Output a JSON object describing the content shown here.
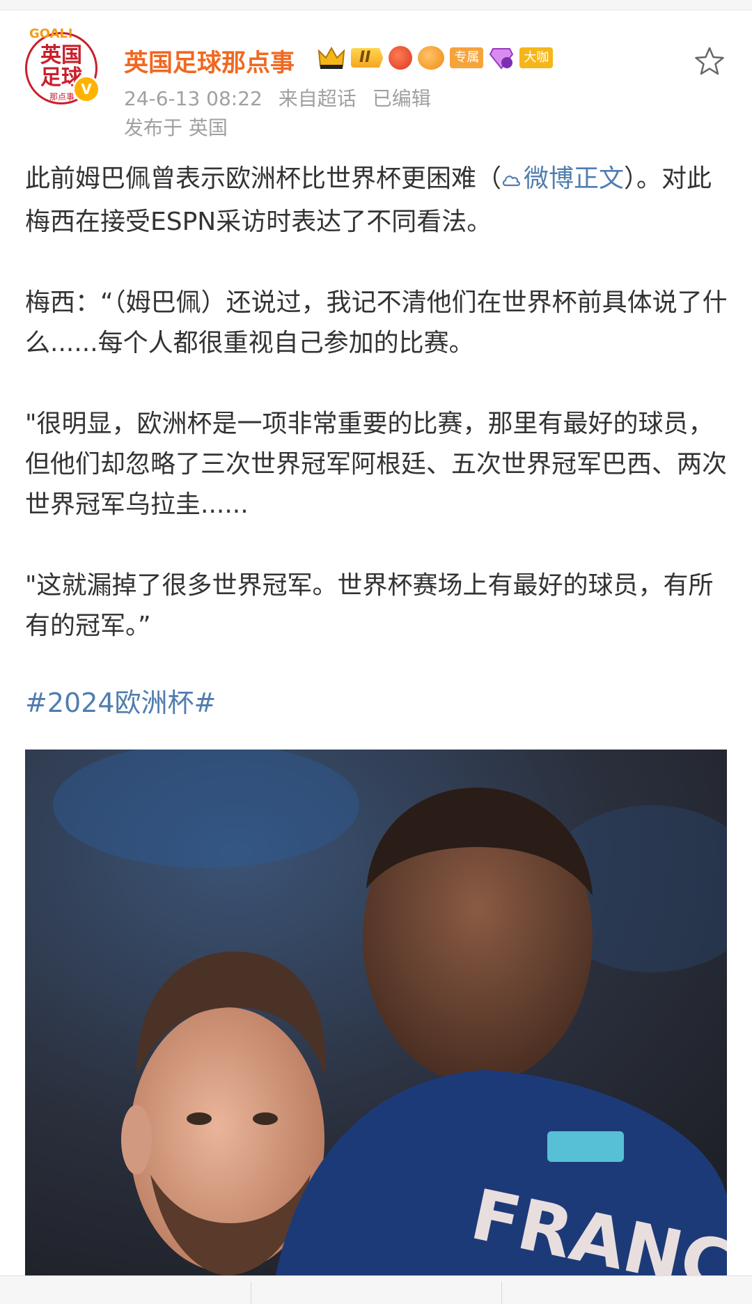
{
  "user": {
    "name": "英国足球那点事",
    "avatar_text_line1": "英国",
    "avatar_text_line2": "足球",
    "avatar_goal": "GOAL!",
    "avatar_small": "那点事",
    "verified": "V",
    "level_badge": "II",
    "tags": [
      "专属",
      "大咖"
    ]
  },
  "post": {
    "time": "24-6-13 08:22",
    "source": "来自超话",
    "edited": "已编辑",
    "location": "发布于 英国",
    "para1_a": "此前姆巴佩曾表示欧洲杯比世界杯更困难（",
    "para1_link": "微博正文",
    "para1_b": "）。对此梅西在接受ESPN采访时表达了不同看法。",
    "para2": "梅西：“（姆巴佩）还说过，我记不清他们在世界杯前具体说了什么......每个人都很重视自己参加的比赛。",
    "para3": "\"很明显，欧洲杯是一项非常重要的比赛，那里有最好的球员，但他们却忽略了三次世界冠军阿根廷、五次世界冠军巴西、两次世界冠军乌拉圭......",
    "para4": "\"这就漏掉了很多世界冠军。世界杯赛场上有最好的球员，有所有的冠军。”",
    "hashtag": "#2024欧洲杯#",
    "jersey_text": "FRANC"
  },
  "colors": {
    "name": "#f06821",
    "link": "#507daf",
    "meta": "#a0a0a0",
    "text": "#333333"
  }
}
